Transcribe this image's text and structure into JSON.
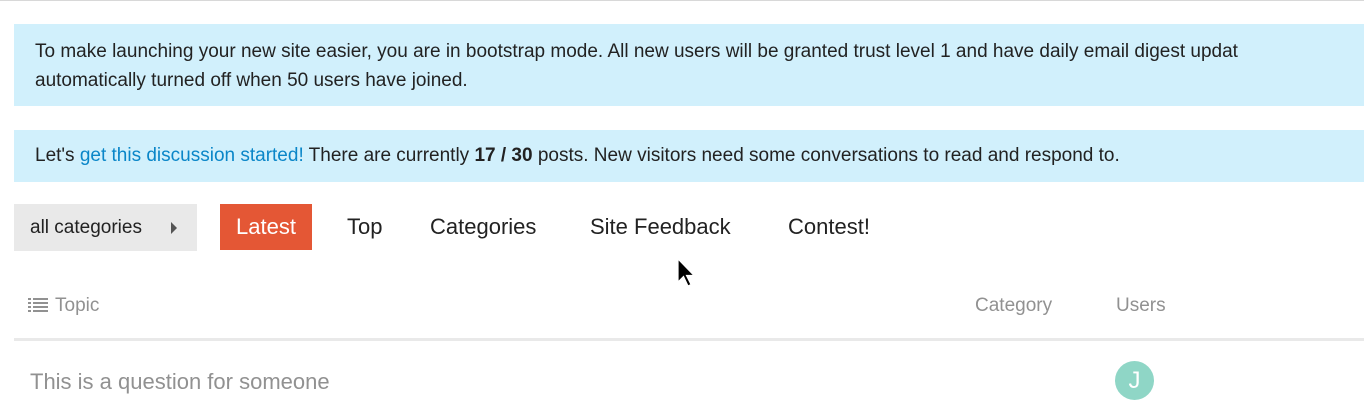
{
  "notices": {
    "bootstrap": {
      "line1": "To make launching your new site easier, you are in bootstrap mode. All new users will be granted trust level 1 and have daily email digest updat",
      "line2": "automatically turned off when 50 users have joined."
    },
    "discussion": {
      "prefix": "Let's ",
      "link": "get this discussion started!",
      "middle": " There are currently ",
      "count": "17 / 30",
      "suffix": " posts. New visitors need some conversations to read and respond to."
    }
  },
  "navigation": {
    "category_dropdown": "all categories",
    "tabs": [
      {
        "label": "Latest",
        "active": true
      },
      {
        "label": "Top",
        "active": false
      },
      {
        "label": "Categories",
        "active": false
      },
      {
        "label": "Site Feedback",
        "active": false
      },
      {
        "label": "Contest!",
        "active": false
      }
    ]
  },
  "topic_list": {
    "columns": {
      "topic": "Topic",
      "category": "Category",
      "users": "Users"
    },
    "rows": [
      {
        "title": "This is a question for someone",
        "category": "",
        "user_initial": "J"
      }
    ]
  },
  "colors": {
    "accent": "#e45735",
    "notice_bg": "#d1f0fc",
    "link": "#0a86c8",
    "avatar_bg": "#8fd6c6"
  },
  "icons": {
    "topic_header": "list-icon",
    "dropdown": "caret-right-icon",
    "pointer": "mouse-cursor"
  }
}
